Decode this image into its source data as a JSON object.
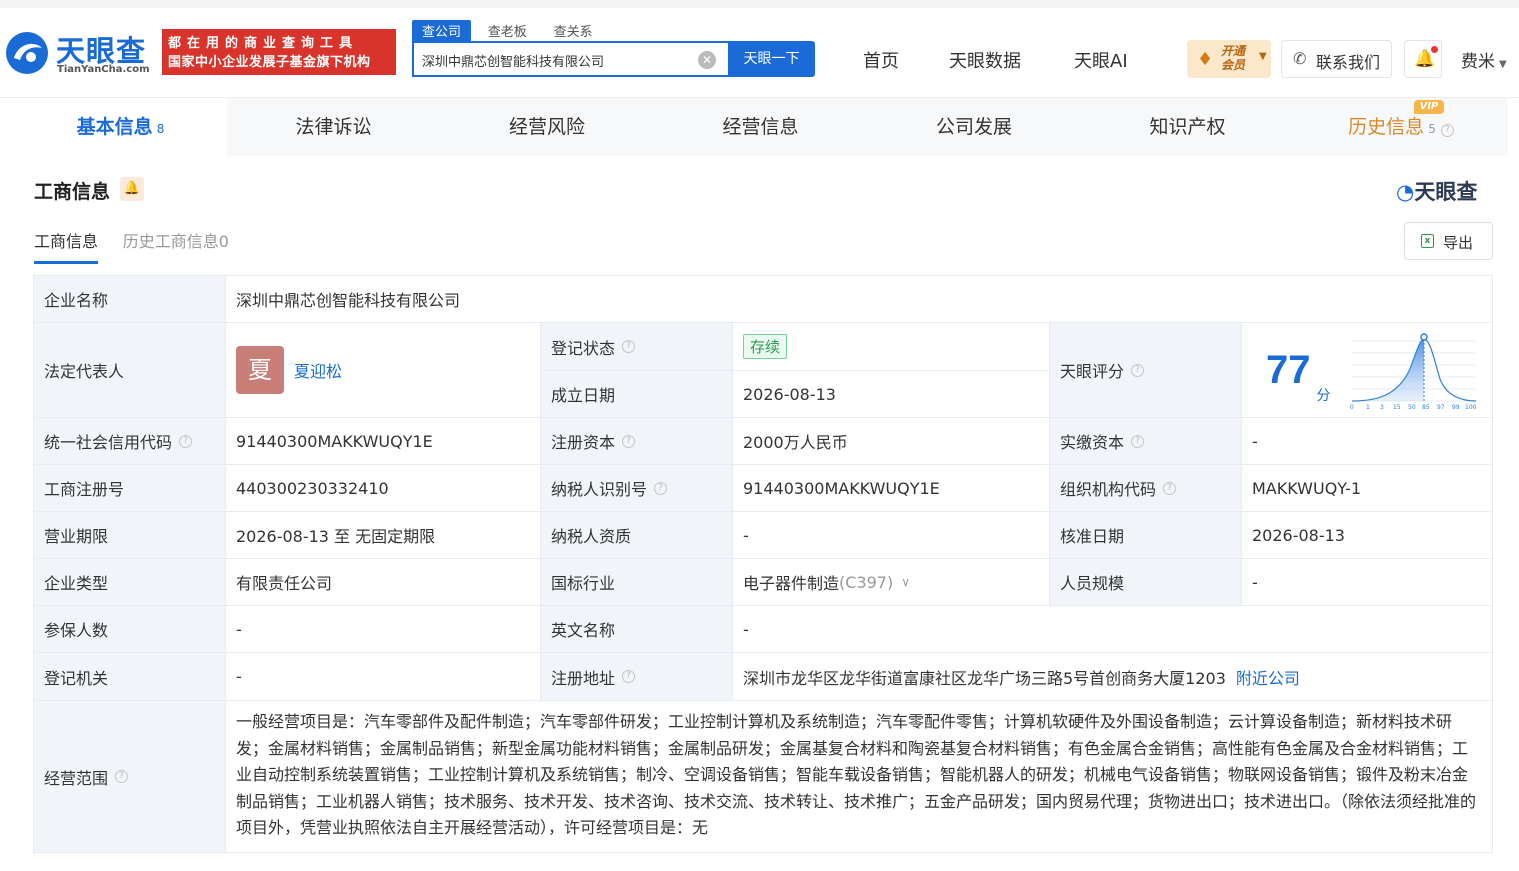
{
  "header": {
    "logo_cn": "天眼查",
    "logo_en": "TianYanCha.com",
    "slogan_line1": "都在用的商业查询工具",
    "slogan_line2": "国家中小企业发展子基金旗下机构",
    "search_tabs": [
      "查公司",
      "查老板",
      "查关系"
    ],
    "search_value": "深圳中鼎芯创智能科技有限公司",
    "search_button": "天眼一下",
    "nav": [
      "首页",
      "天眼数据",
      "天眼AI"
    ],
    "vip_text_line1": "开通",
    "vip_text_line2": "会员",
    "contact": "联系我们",
    "user": "费米"
  },
  "tabs": [
    {
      "label": "基本信息",
      "count": "8",
      "active": true
    },
    {
      "label": "法律诉讼"
    },
    {
      "label": "经营风险"
    },
    {
      "label": "经营信息"
    },
    {
      "label": "公司发展"
    },
    {
      "label": "知识产权"
    },
    {
      "label": "历史信息",
      "count": "5",
      "vip": true
    }
  ],
  "vip_badge": "VIP",
  "section": {
    "title": "工商信息",
    "brand": "天眼查",
    "subtabs": [
      "工商信息",
      "历史工商信息0"
    ],
    "export": "导出"
  },
  "info": {
    "company_name_label": "企业名称",
    "company_name": "深圳中鼎芯创智能科技有限公司",
    "legal_rep_label": "法定代表人",
    "legal_rep_avatar": "夏",
    "legal_rep": "夏迎松",
    "reg_status_label": "登记状态",
    "reg_status": "存续",
    "found_date_label": "成立日期",
    "found_date": "2026-08-13",
    "score_label": "天眼评分",
    "score": "77",
    "score_unit": "分",
    "score_axis": [
      "0",
      "1",
      "3",
      "15",
      "50",
      "85",
      "97",
      "99",
      "100"
    ],
    "credit_code_label": "统一社会信用代码",
    "credit_code": "91440300MAKKWUQY1E",
    "reg_capital_label": "注册资本",
    "reg_capital": "2000万人民币",
    "paid_capital_label": "实缴资本",
    "paid_capital": "-",
    "biz_reg_no_label": "工商注册号",
    "biz_reg_no": "440300230332410",
    "taxpayer_id_label": "纳税人识别号",
    "taxpayer_id": "91440300MAKKWUQY1E",
    "org_code_label": "组织机构代码",
    "org_code": "MAKKWUQY-1",
    "term_label": "营业期限",
    "term": "2026-08-13 至 无固定期限",
    "taxpayer_qual_label": "纳税人资质",
    "taxpayer_qual": "-",
    "approve_date_label": "核准日期",
    "approve_date": "2026-08-13",
    "type_label": "企业类型",
    "type": "有限责任公司",
    "industry_label": "国标行业",
    "industry": "电子器件制造",
    "industry_code": "(C397)",
    "staff_label": "人员规模",
    "staff": "-",
    "insured_label": "参保人数",
    "insured": "-",
    "english_label": "英文名称",
    "english": "-",
    "authority_label": "登记机关",
    "authority": "-",
    "address_label": "注册地址",
    "address": "深圳市龙华区龙华街道富康社区龙华广场三路5号首创商务大厦1203",
    "nearby": "附近公司",
    "scope_label": "经营范围",
    "scope": "一般经营项目是：汽车零部件及配件制造；汽车零部件研发；工业控制计算机及系统制造；汽车零配件零售；计算机软硬件及外围设备制造；云计算设备制造；新材料技术研发；金属材料销售；金属制品销售；新型金属功能材料销售；金属制品研发；金属基复合材料和陶瓷基复合材料销售；有色金属合金销售；高性能有色金属及合金材料销售；工业自动控制系统装置销售；工业控制计算机及系统销售；制冷、空调设备销售；智能车载设备销售；智能机器人的研发；机械电气设备销售；物联网设备销售；锻件及粉末冶金制品销售；工业机器人销售；技术服务、技术开发、技术咨询、技术交流、技术转让、技术推广；五金产品研发；国内贸易代理；货物进出口；技术进出口。（除依法须经批准的项目外，凭营业执照依法自主开展经营活动），许可经营项目是：无"
  },
  "colors": {
    "brand_blue": "#1a6bd6",
    "slogan_red": "#d9342b",
    "status_green": "#2f9b56",
    "vip_gold": "#d98b2a"
  }
}
